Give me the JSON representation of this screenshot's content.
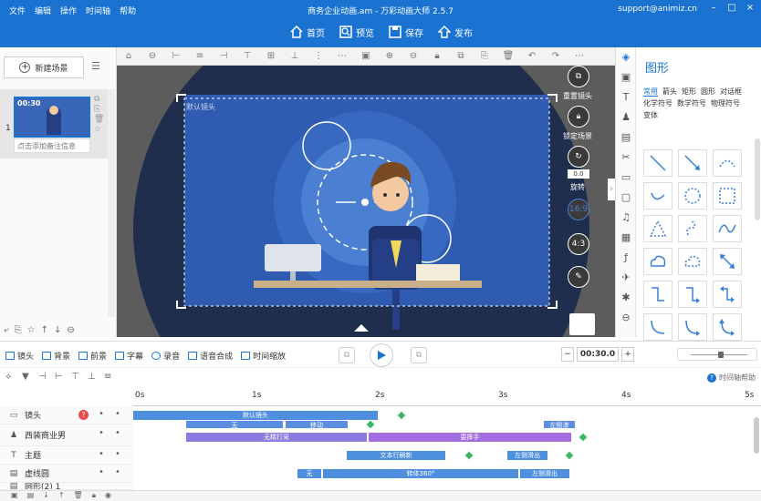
{
  "titlebar": {
    "menus": [
      "文件",
      "编辑",
      "操作",
      "时间轴",
      "帮助"
    ],
    "title": "商务企业动画.am - 万彩动画大师 2.5.7",
    "email": "support@animiz.cn",
    "actions": [
      "首页",
      "预览",
      "保存",
      "发布"
    ]
  },
  "scenes": {
    "new_label": "新建场景",
    "index": "1",
    "time": "00:30",
    "note": "点击添加备注信息"
  },
  "stage": {
    "camera_label": "默认镜头",
    "side_buttons": [
      "重置镜头",
      "锁定场景",
      "旋转"
    ],
    "rotation_value": "0.0",
    "ratio_169": "16:9",
    "ratio_43": "4:3"
  },
  "shapes_panel": {
    "title": "图形",
    "tabs": [
      "常用",
      "箭头",
      "矩形",
      "圆形",
      "对话框",
      "化学符号",
      "数学符号",
      "物理符号",
      "变体"
    ],
    "active_tab": "常用"
  },
  "timeline": {
    "layer_buttons": [
      "镜头",
      "背景",
      "前景",
      "字幕",
      "录音",
      "语音合成",
      "时间缩放"
    ],
    "time_value": "00:30.0",
    "help": "时间轴帮助",
    "ruler": [
      "0s",
      "1s",
      "2s",
      "3s",
      "4s",
      "5s"
    ],
    "tracks": [
      {
        "name": "镜头",
        "icon": "camera-icon",
        "bars": [
          {
            "label": "默认镜头",
            "color": "#4f8fe0"
          }
        ]
      },
      {
        "name": "西装商业男",
        "icon": "person-icon",
        "bars": [
          {
            "label": "无",
            "color": "#5b8de0"
          },
          {
            "label": "移动",
            "color": "#5b8de0"
          },
          {
            "label": "左侧渗",
            "color": "#5b8de0"
          },
          {
            "label": "无精打采",
            "color": "#8c7be0"
          },
          {
            "label": "耍摔手",
            "color": "#a46ee0"
          }
        ]
      },
      {
        "name": "主题",
        "icon": "text-icon",
        "bars": [
          {
            "label": "文本行刷新",
            "color": "#4f8fe0"
          },
          {
            "label": "左侧滑出",
            "color": "#4f8fe0"
          }
        ]
      },
      {
        "name": "虚线圆",
        "icon": "shape-icon",
        "bars": [
          {
            "label": "无",
            "color": "#4f8fe0"
          },
          {
            "label": "转体360°",
            "color": "#4f8fe0"
          },
          {
            "label": "左侧滑出",
            "color": "#4f8fe0"
          }
        ]
      },
      {
        "name": "圆形(2) 1",
        "icon": "shape-icon",
        "bars": []
      }
    ]
  },
  "colors": {
    "brand": "#1a73d1",
    "stage_bg": "#5c5c5c",
    "scene_blue": "#2f5bb0"
  }
}
